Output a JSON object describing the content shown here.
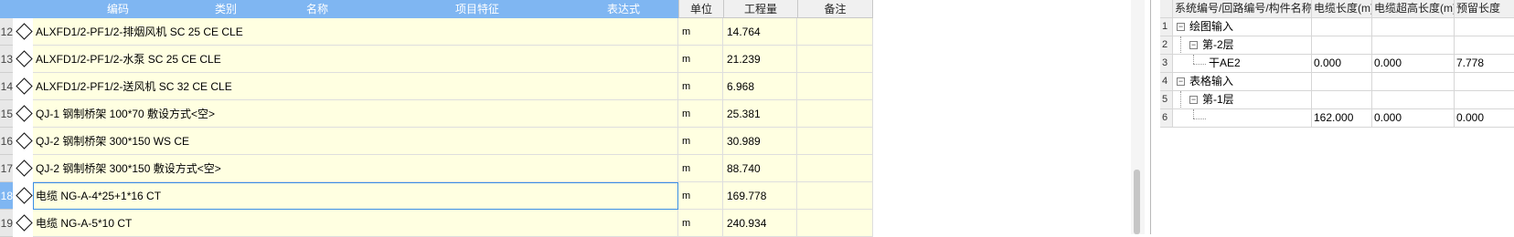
{
  "left_grid": {
    "headers": {
      "code": "编码",
      "category": "类别",
      "name": "名称",
      "feature": "项目特征",
      "expression": "表达式",
      "unit": "单位",
      "quantity": "工程量",
      "remark": "备注"
    },
    "rows": [
      {
        "num": "12",
        "name": "ALXFD1/2-PF1/2-排烟风机 SC 25 CE CLE",
        "unit": "m",
        "qty": "14.764",
        "note": ""
      },
      {
        "num": "13",
        "name": "ALXFD1/2-PF1/2-水泵 SC 25 CE CLE",
        "unit": "m",
        "qty": "21.239",
        "note": ""
      },
      {
        "num": "14",
        "name": "ALXFD1/2-PF1/2-送风机 SC 32 CE CLE",
        "unit": "m",
        "qty": "6.968",
        "note": ""
      },
      {
        "num": "15",
        "name": "QJ-1 钢制桥架 100*70 敷设方式<空>",
        "unit": "m",
        "qty": "25.381",
        "note": ""
      },
      {
        "num": "16",
        "name": "QJ-2 钢制桥架 300*150 WS CE",
        "unit": "m",
        "qty": "30.989",
        "note": ""
      },
      {
        "num": "17",
        "name": "QJ-2 钢制桥架 300*150 敷设方式<空>",
        "unit": "m",
        "qty": "88.740",
        "note": ""
      },
      {
        "num": "18",
        "name": "电缆 NG-A-4*25+1*16 CT",
        "unit": "m",
        "qty": "169.778",
        "note": "",
        "selected": true
      },
      {
        "num": "19",
        "name": "电缆 NG-A-5*10 CT",
        "unit": "m",
        "qty": "240.934",
        "note": ""
      }
    ]
  },
  "right_grid": {
    "headers": {
      "col1": "系统编号/回路编号/构件名称",
      "col2": "电缆长度(m)",
      "col3": "电缆超高长度(m)",
      "col4": "预留长度"
    },
    "rows": [
      {
        "num": "1",
        "label": "绘图输入",
        "c2": "",
        "c3": "",
        "c4": ""
      },
      {
        "num": "2",
        "label": "第-2层",
        "c2": "",
        "c3": "",
        "c4": ""
      },
      {
        "num": "3",
        "label": "干AE2",
        "c2": "0.000",
        "c3": "0.000",
        "c4": "7.778"
      },
      {
        "num": "4",
        "label": "表格输入",
        "c2": "",
        "c3": "",
        "c4": ""
      },
      {
        "num": "5",
        "label": "第-1层",
        "c2": "",
        "c3": "",
        "c4": ""
      },
      {
        "num": "6",
        "label": "",
        "c2": "162.000",
        "c3": "0.000",
        "c4": "0.000"
      }
    ],
    "collapse_glyph": "−"
  },
  "colors": {
    "header_blue": "#7fb6f2",
    "row_yellow": "#ffffe1",
    "selection_border": "#3a8ee6"
  }
}
